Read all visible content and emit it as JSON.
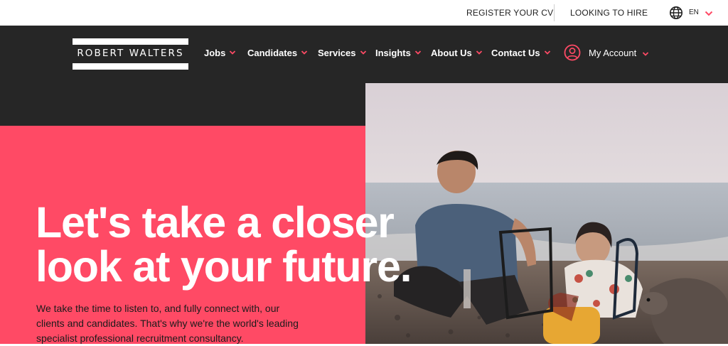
{
  "topbar": {
    "register_label": "REGISTER YOUR CV",
    "hire_label": "LOOKING TO HIRE",
    "language": "EN",
    "globe_icon": "globe-icon"
  },
  "nav": {
    "logo_text": "ROBERT WALTERS",
    "items": [
      {
        "label": "Jobs"
      },
      {
        "label": "Candidates"
      },
      {
        "label": "Services"
      },
      {
        "label": "Insights"
      },
      {
        "label": "About Us"
      },
      {
        "label": "Contact Us"
      }
    ],
    "account_label": "My Account"
  },
  "hero": {
    "title_line1": "Let's take a closer",
    "title_line2": "look at your future.",
    "subtitle": "We take the time to listen to, and fully connect with, our clients and candidates. That's why we're the world's leading specialist professional recruitment consultancy."
  },
  "colors": {
    "brand_pink": "#ff4a65",
    "nav_dark": "#262626",
    "accent_chevron": "#ff4a65"
  }
}
